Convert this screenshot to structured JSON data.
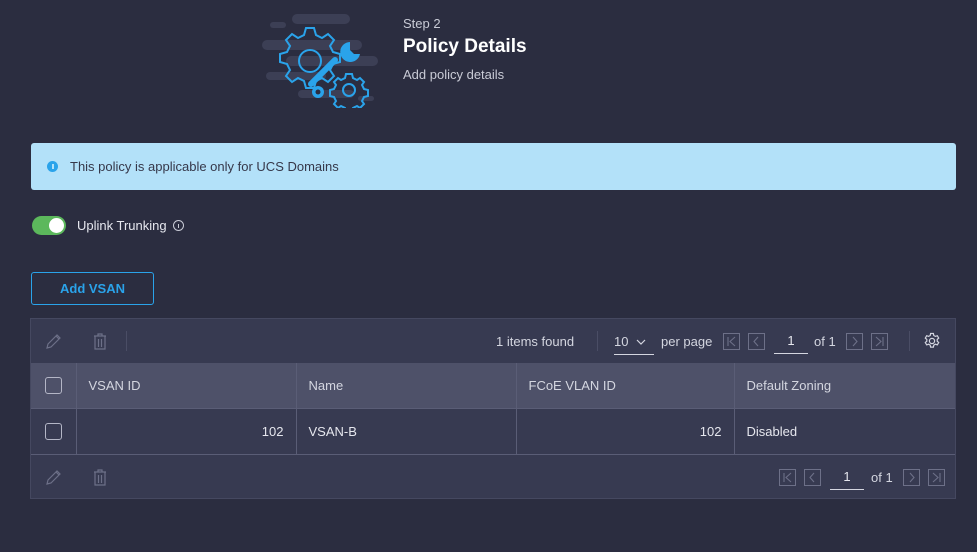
{
  "header": {
    "step": "Step 2",
    "title": "Policy Details",
    "subtitle": "Add policy details",
    "hero_icon": "gears-wrench-icon"
  },
  "banner": {
    "icon": "info-icon",
    "text": "This policy is applicable only for UCS Domains",
    "color": "#b3e1f9"
  },
  "uplink_trunking": {
    "label": "Uplink Trunking",
    "enabled": true,
    "color": "#5cb85c"
  },
  "add_button": {
    "label": "Add VSAN",
    "color": "#2aa3ea"
  },
  "grid": {
    "items_found": "1 items found",
    "per_page_value": "10",
    "per_page_label": "per page",
    "page_value": "1",
    "page_of": "of 1",
    "columns": [
      "VSAN ID",
      "Name",
      "FCoE VLAN ID",
      "Default Zoning"
    ],
    "rows": [
      {
        "vsan_id": "102",
        "name": "VSAN-B",
        "fcoe_vlan_id": "102",
        "default_zoning": "Disabled"
      }
    ],
    "footer_page_value": "1",
    "footer_page_of": "of 1"
  }
}
